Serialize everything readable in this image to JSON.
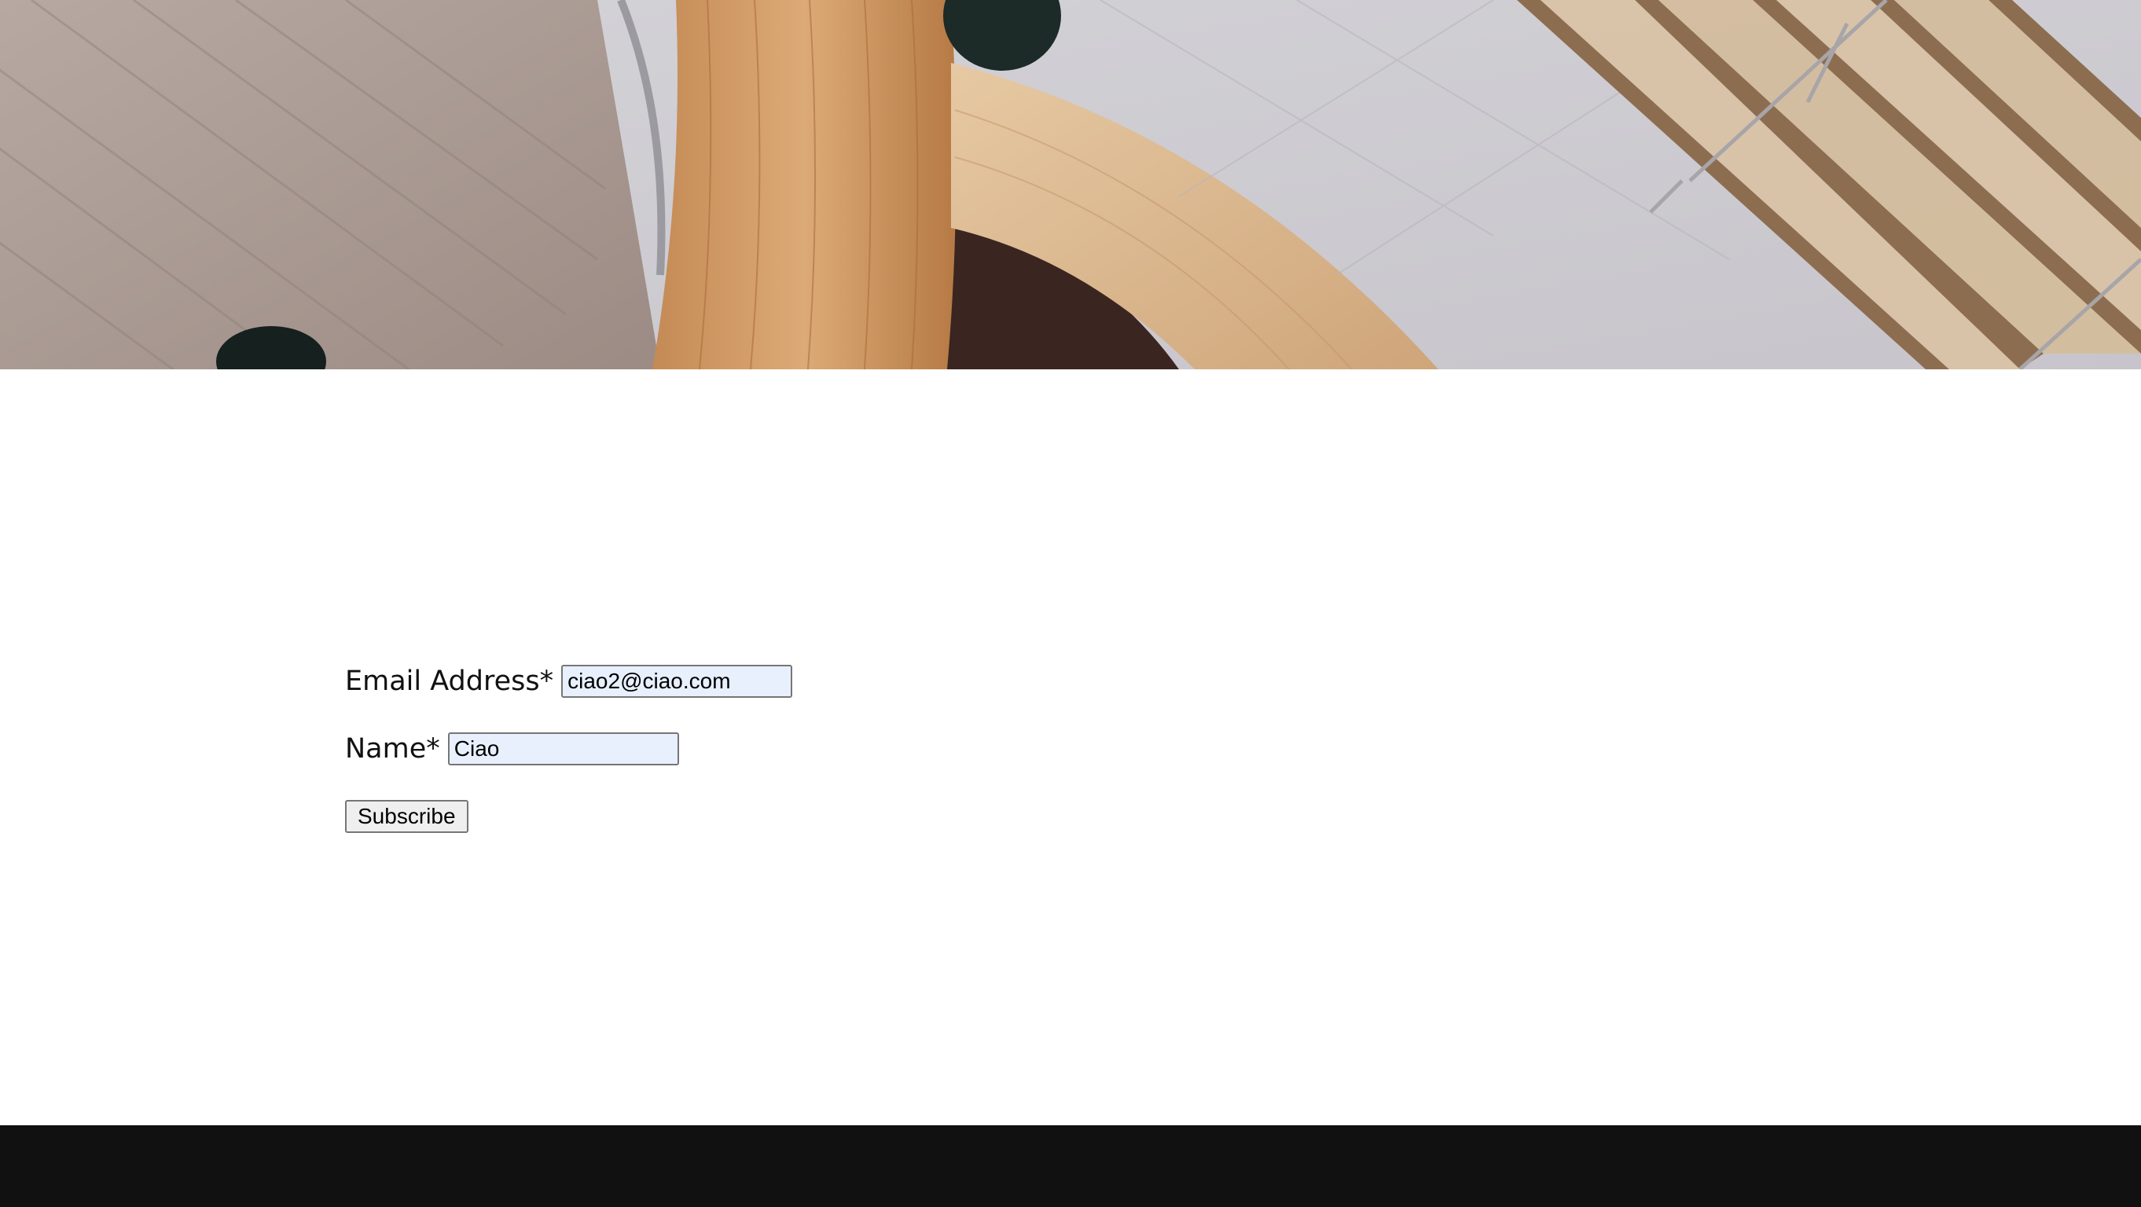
{
  "hero": {
    "image_icon": "architectural-atrium-photo"
  },
  "form": {
    "email": {
      "label": "Email Address*",
      "value": "ciao2@ciao.com"
    },
    "name": {
      "label": "Name*",
      "value": "Ciao"
    },
    "submit_label": "Subscribe"
  },
  "colors": {
    "footer_bg": "#111111",
    "autofill_bg": "#e8f0fe",
    "page_bg": "#ffffff"
  }
}
